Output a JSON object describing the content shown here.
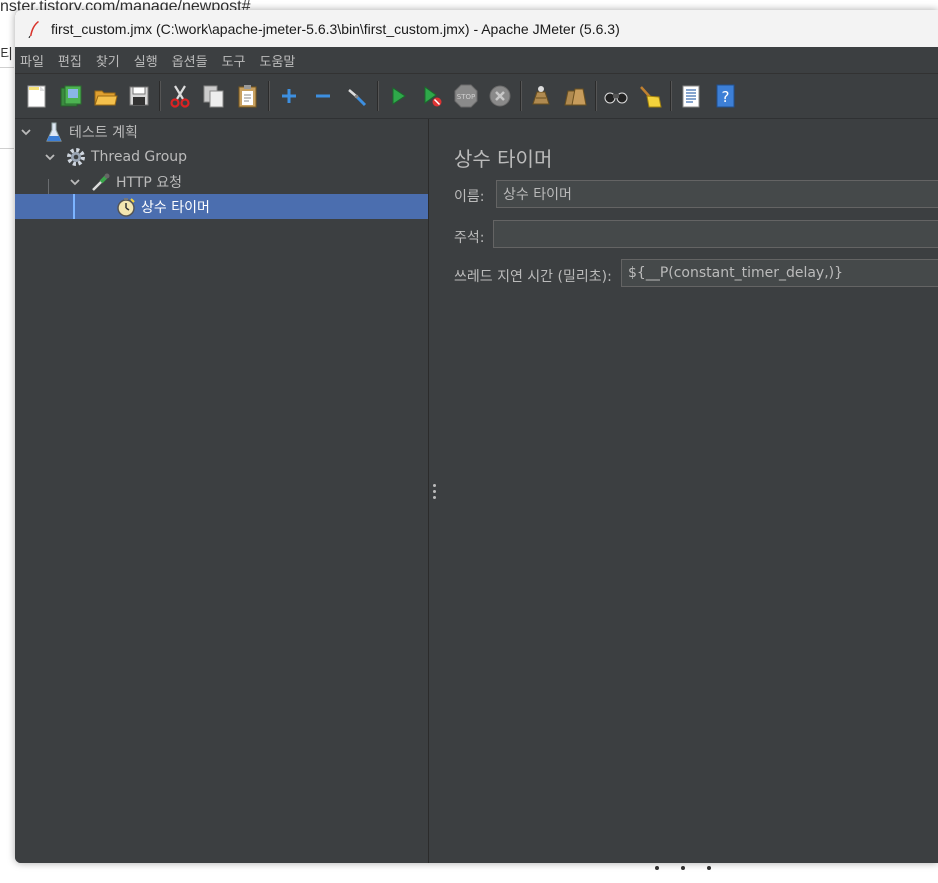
{
  "background": {
    "url_fragment": "nster.tistory.com/manage/newpost#",
    "left_char": "티"
  },
  "window": {
    "title": "first_custom.jmx (C:\\work\\apache-jmeter-5.6.3\\bin\\first_custom.jmx) - Apache JMeter (5.6.3)"
  },
  "menu": [
    "파일",
    "편집",
    "찾기",
    "실행",
    "옵션들",
    "도구",
    "도움말"
  ],
  "toolbar": [
    "new-icon",
    "templates-icon",
    "open-icon",
    "save-icon",
    "cut-icon",
    "copy-icon",
    "paste-icon",
    "expand-icon",
    "collapse-icon",
    "toggle-icon",
    "start-icon",
    "start-no-pause-icon",
    "stop-icon",
    "shutdown-icon",
    "clear-icon",
    "clear-all-icon",
    "search-icon",
    "reset-search-icon",
    "function-helper-icon",
    "help-icon"
  ],
  "tree": {
    "test_plan": "테스트 계획",
    "thread_group": "Thread Group",
    "http_request": "HTTP 요청",
    "constant_timer": "상수 타이머"
  },
  "editor": {
    "title": "상수 타이머",
    "name_label": "이름:",
    "name_value": "상수 타이머",
    "comment_label": "주석:",
    "comment_value": "",
    "delay_label": "쓰레드 지연 시간 (밀리초):",
    "delay_value": "${__P(constant_timer_delay,)}"
  },
  "colors": {
    "window_bg": "#3c3f41",
    "selection": "#4b6eaf",
    "text": "#bbbbbb",
    "input_bg": "#45494a"
  }
}
